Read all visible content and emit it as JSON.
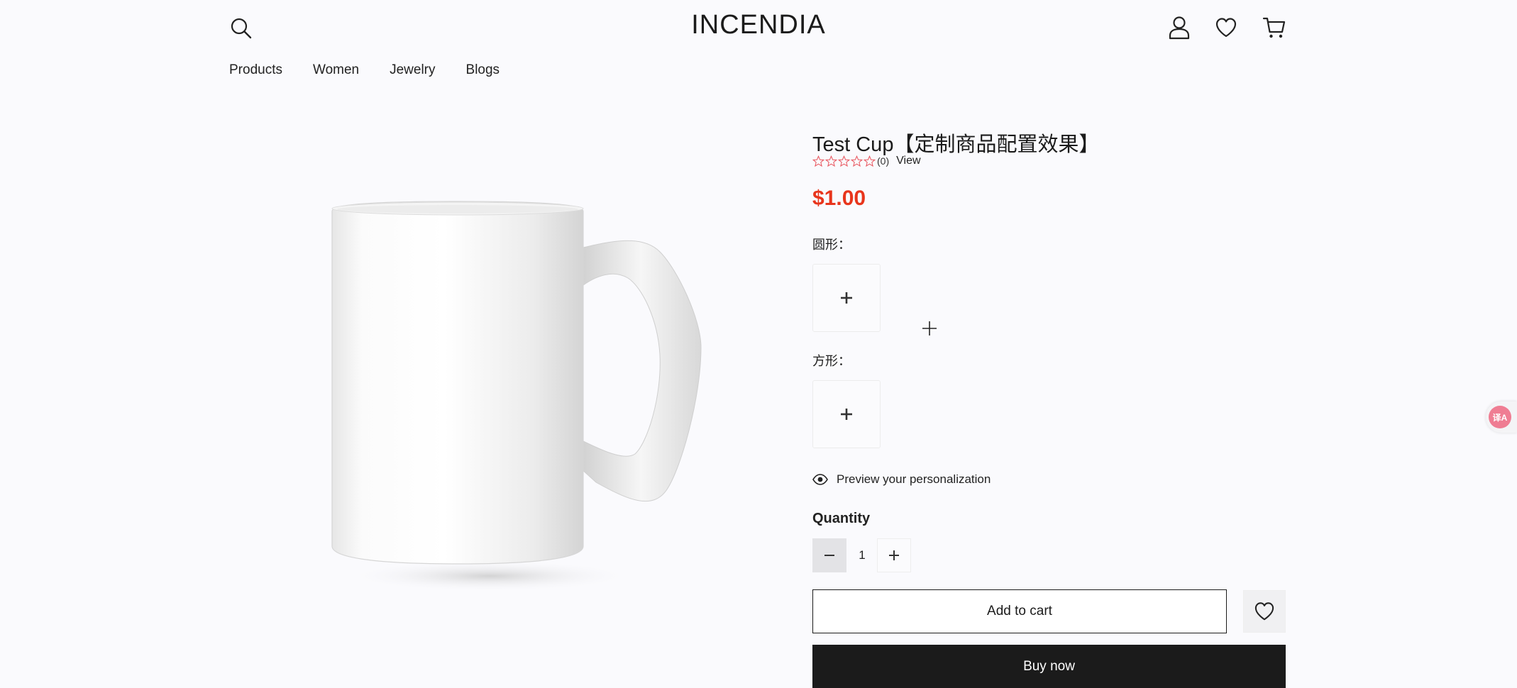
{
  "brand": {
    "logo": "INCENDIA"
  },
  "nav": {
    "items": [
      "Products",
      "Women",
      "Jewelry",
      "Blogs"
    ]
  },
  "product": {
    "title": "Test Cup【定制商品配置效果】",
    "rating_count": "(0)",
    "rating_stars": 0,
    "view_label": "View",
    "price": "$1.00",
    "image_alt": "white-mug"
  },
  "options": {
    "circle_label": "圆形：",
    "square_label": "方形："
  },
  "preview": {
    "label": "Preview your personalization"
  },
  "quantity": {
    "label": "Quantity",
    "value": "1"
  },
  "actions": {
    "add_to_cart": "Add to cart",
    "buy_now": "Buy now"
  },
  "translate": {
    "badge": "译A"
  },
  "colors": {
    "accent_price": "#e8351c",
    "buy_now_bg": "#1b1b1b",
    "background": "#fafafd",
    "star_outline": "#e8535c"
  },
  "icons": {
    "header": [
      "search-icon",
      "user-icon",
      "heart-icon",
      "cart-icon"
    ],
    "preview": "eye-icon",
    "wishlist": "heart-icon"
  }
}
